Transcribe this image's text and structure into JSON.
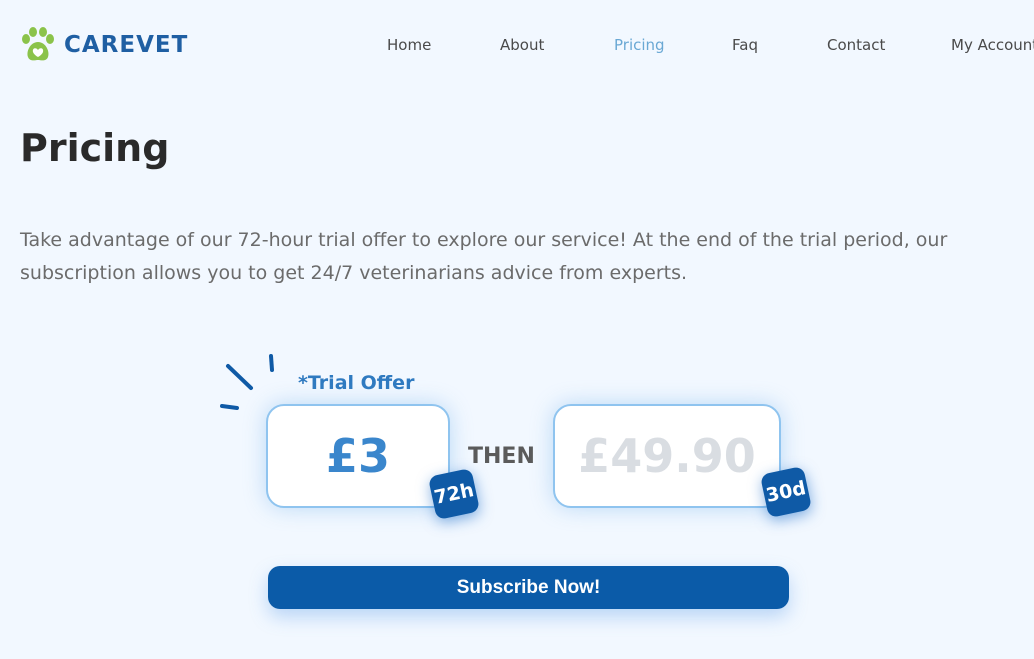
{
  "brand": {
    "name": "CAREVET",
    "logo_icon": "paw-icon"
  },
  "nav": {
    "items": [
      {
        "label": "Home",
        "active": false
      },
      {
        "label": "About",
        "active": false
      },
      {
        "label": "Pricing",
        "active": true
      },
      {
        "label": "Faq",
        "active": false
      },
      {
        "label": "Contact",
        "active": false
      },
      {
        "label": "My Account",
        "active": false
      }
    ]
  },
  "page": {
    "title": "Pricing",
    "intro": "Take advantage of our 72-hour trial offer to explore our service! At the end of the trial period, our subscription allows you to get 24/7 veterinarians advice from experts."
  },
  "pricing": {
    "trial_label": "*Trial Offer",
    "trial_price": "£3",
    "trial_duration": "72h",
    "then_label": "THEN",
    "full_price": "£49.90",
    "full_duration": "30d"
  },
  "cta": {
    "subscribe_label": "Subscribe Now!"
  },
  "colors": {
    "background": "#f2f8ff",
    "brand": "#1f5fa3",
    "accent": "#3a86cc",
    "nav_active": "#6aa8d4",
    "button": "#0b5ba8",
    "logo_green": "#8bc34a"
  }
}
